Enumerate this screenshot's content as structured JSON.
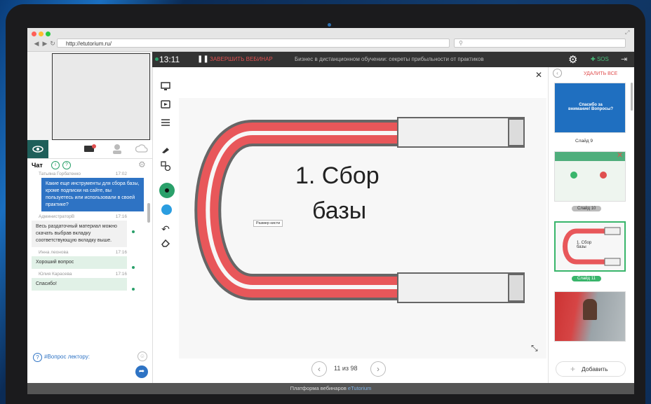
{
  "browser": {
    "url": "http://etutorium.ru/",
    "traffic_colors": [
      "#ff5f57",
      "#ffbd2e",
      "#28c940"
    ]
  },
  "topbar": {
    "timer": "13:11",
    "end_webinar": "ЗАВЕРШИТЬ ВЕБИНАР",
    "title": "Бизнес в дистанционном обучении: секреты прибыльности от практиков",
    "sos": "SOS"
  },
  "left": {
    "chat_title": "Чат",
    "messages": [
      {
        "author": "Татьяна Горбатенко",
        "time": "17:02",
        "text": "Какие еще инструменты для сбора базы, кроме подписки на сайте, вы пользуетесь или использовали в своей практике?",
        "style": "blue"
      },
      {
        "author": "АдминистраторВ",
        "time": "17:16",
        "text": "Весь раздаточный материал можно скачать выбрав вкладку соответствующую вкладку выше.",
        "style": "grey"
      },
      {
        "author": "Инна леонова",
        "time": "17:16",
        "text": "Хороший вопрос",
        "style": "green"
      },
      {
        "author": "Юлия Карасева",
        "time": "17:16",
        "text": "Спасибо!",
        "style": "green"
      }
    ],
    "question_label": "#Вопрос лектору:"
  },
  "slide": {
    "title_line1": "1. Сбор",
    "title_line2": "базы",
    "tooltip": "Размер кисти"
  },
  "pager": {
    "text": "11 из 98"
  },
  "right": {
    "delete_all": "УДАЛИТЬ ВСЕ",
    "slides": [
      {
        "label": "Слайд 9",
        "text": "Спасибо за внимание! Вопросы?"
      },
      {
        "label": "Слайд 10"
      },
      {
        "label": "Слайд 11",
        "text": "1. Сбор базы"
      },
      {
        "label": ""
      }
    ],
    "add_label": "Добавить"
  },
  "footer": {
    "text": "Платформа вебинаров",
    "brand": "eTutorium"
  },
  "colors": {
    "accent_green": "#2aa06a",
    "magnet_red": "#e8575a",
    "chat_blue": "#2e73c4",
    "topbar": "#333333"
  }
}
